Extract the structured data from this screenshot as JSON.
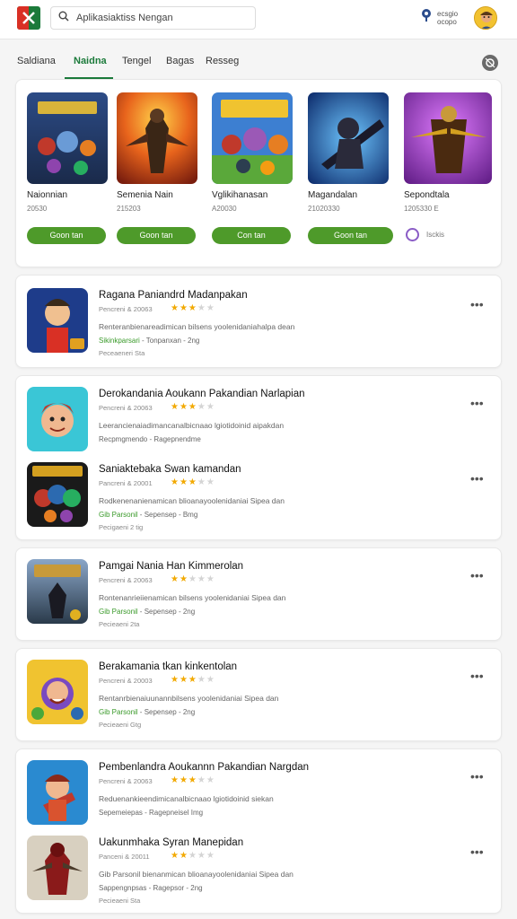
{
  "header": {
    "search_placeholder": "Aplikasiaktiss Nengan",
    "right_text": "ecsgio\nocopo",
    "colors": {
      "brand_green": "#1b7a3a",
      "brand_red": "#d93025"
    }
  },
  "tabs": [
    "Saldiana",
    "Naidna",
    "Tengel",
    "Bagas",
    "Resseg"
  ],
  "active_tab": 1,
  "featured": {
    "items": [
      {
        "name": "Naionnian",
        "meta": "20530",
        "button": "Goon tan"
      },
      {
        "name": "Semenia Nain",
        "meta": "215203",
        "button": "Goon tan"
      },
      {
        "name": "Vglikihanasan",
        "meta": "A20030",
        "button": "Con tan"
      },
      {
        "name": "Magandalan",
        "meta": "21020330",
        "button": "Goon tan"
      },
      {
        "name": "Sepondtala",
        "meta": "1205330 E"
      }
    ],
    "more_label": "Isckis"
  },
  "list": [
    {
      "title": "Ragana Paniandrd Madanpakan",
      "sub": "Pencreni & 20063",
      "stars": 3,
      "desc": "Renteranbienareadimican bilsens yoolenidaniahalpa dean",
      "info_badge": "Sikinkparsari",
      "info": " - Tonpanxan - 2ng",
      "foot": "Peceaeneri Sta"
    },
    {
      "title": "Derokandania Aoukann Pakandian Narlapian",
      "sub": "Pencreni & 20063",
      "stars": 3,
      "desc": "Leerancienaiadimancanalbicnaao lgiotidoinid aipakdan",
      "info_badge": "",
      "info": "Recpmgmendo - Ragepnendme",
      "foot": ""
    },
    {
      "title": "Saniaktebaka Swan kamandan",
      "sub": "Pancreni & 20001",
      "stars": 3,
      "desc": "Rodkenenanienamican blioanayoolenidaniai Sipea dan",
      "info_badge": "Gib Parsonil",
      "info": " - Sepensep - Bmg",
      "foot": "Pecigaeni 2 tig"
    },
    {
      "title": "Pamgai Nania Han Kimmerolan",
      "sub": "Pencreni & 20063",
      "stars": 2,
      "desc": "Rontenanrieiienamican bilsens yoolenidaniai Sipea dan",
      "info_badge": "Gib Parsonil",
      "info": " - Sepensep - 2ng",
      "foot": "Pecieaeni 2ta"
    },
    {
      "title": "Berakamania tkan kinkentolan",
      "sub": "Pencreni & 20003",
      "stars": 3,
      "desc": "Rentanrbienaiuunannbilsens yoolenidaniai Sipea dan",
      "info_badge": "Gib Parsonil",
      "info": " - Sepensep - 2ng",
      "foot": "Pecieaeni Gtg"
    },
    {
      "title": "Pembenlandra Aoukannn Pakandian Nargdan",
      "sub": "Pencreni & 20063",
      "stars": 3,
      "desc": "Reduenankieendimicanalbicnaao lgiotidoinid siekan",
      "info_badge": "",
      "info": "Sepemeiepas - Ragepneisel Img",
      "foot": ""
    },
    {
      "title": "Uakunmhaka Syran Manepidan",
      "sub": "Panceni & 20011",
      "stars": 2,
      "desc": "Gib Parsonil bienanmican blioanayoolenidaniai Sipea dan",
      "info_badge": "",
      "info": "Sappengnpsas - Ragepsor - 2ng",
      "foot": "Pecieaeni Sta"
    }
  ]
}
